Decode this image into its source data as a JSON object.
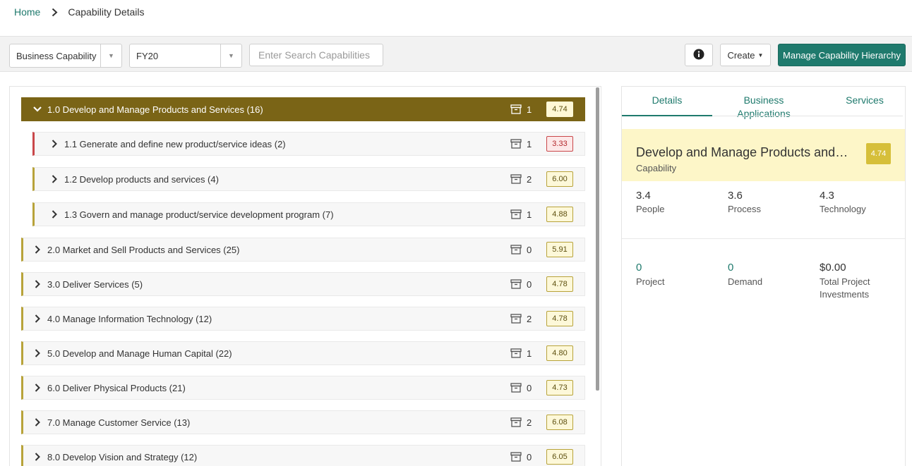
{
  "breadcrumb": {
    "home": "Home",
    "current": "Capability Details"
  },
  "toolbar": {
    "type_select": "Business Capability",
    "year_select": "FY20",
    "search_placeholder": "Enter Search Capabilities",
    "create_label": "Create",
    "manage_label": "Manage Capability Hierarchy"
  },
  "tree": {
    "rows": [
      {
        "label": "1.0 Develop and Manage Products and Services (16)",
        "count": "1",
        "score": "4.74"
      },
      {
        "label": "1.1 Generate and define new product/service ideas (2)",
        "count": "1",
        "score": "3.33"
      },
      {
        "label": "1.2 Develop products and services (4)",
        "count": "2",
        "score": "6.00"
      },
      {
        "label": "1.3 Govern and manage product/service development program (7)",
        "count": "1",
        "score": "4.88"
      },
      {
        "label": "2.0 Market and Sell Products and Services (25)",
        "count": "0",
        "score": "5.91"
      },
      {
        "label": "3.0 Deliver Services (5)",
        "count": "0",
        "score": "4.78"
      },
      {
        "label": "4.0 Manage Information Technology (12)",
        "count": "2",
        "score": "4.78"
      },
      {
        "label": "5.0 Develop and Manage Human Capital (22)",
        "count": "1",
        "score": "4.80"
      },
      {
        "label": "6.0 Deliver Physical Products (21)",
        "count": "0",
        "score": "4.73"
      },
      {
        "label": "7.0 Manage Customer Service (13)",
        "count": "2",
        "score": "6.08"
      },
      {
        "label": "8.0 Develop Vision and Strategy (12)",
        "count": "0",
        "score": "6.05"
      }
    ]
  },
  "details": {
    "tabs": [
      {
        "label": "Details"
      },
      {
        "label": "Business Applications"
      },
      {
        "label": "Services"
      }
    ],
    "title": "Develop and Manage Products and Services",
    "type": "Capability",
    "score": "4.74",
    "metrics": [
      {
        "value": "3.4",
        "label": "People"
      },
      {
        "value": "3.6",
        "label": "Process"
      },
      {
        "value": "4.3",
        "label": "Technology"
      }
    ],
    "stats": [
      {
        "value": "0",
        "label": "Project"
      },
      {
        "value": "0",
        "label": "Demand"
      },
      {
        "value": "$0.00",
        "label": "Total Project Investments"
      }
    ]
  },
  "colors": {
    "accent": "#1f7a6d",
    "olive": "#7a6416",
    "score_bg": "#fdf8d9",
    "score_red": "#c9474a",
    "highlight": "#fdf6c8"
  }
}
